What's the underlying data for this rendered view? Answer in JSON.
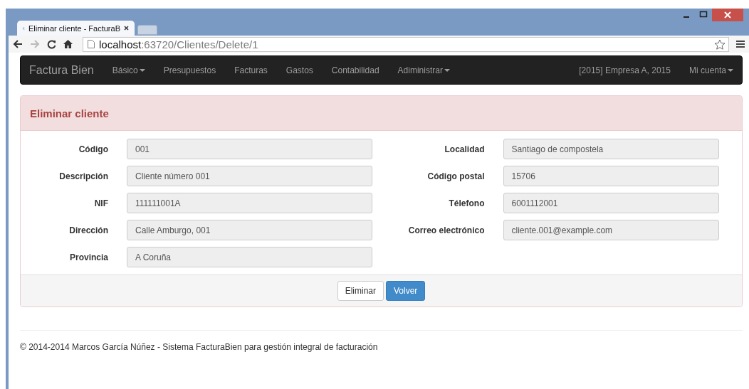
{
  "browser": {
    "tabs": [
      {
        "title": "Eliminar cliente - FacturaB",
        "selected": true
      }
    ],
    "address": {
      "host": "localhost",
      "path": ":63720/Clientes/Delete/1"
    }
  },
  "navbar": {
    "brand": "Factura Bien",
    "items": [
      {
        "label": "Básico",
        "dropdown": true
      },
      {
        "label": "Presupuestos",
        "dropdown": false
      },
      {
        "label": "Facturas",
        "dropdown": false
      },
      {
        "label": "Gastos",
        "dropdown": false
      },
      {
        "label": "Contabilidad",
        "dropdown": false
      },
      {
        "label": "Adiministrar",
        "dropdown": true
      }
    ],
    "right_items": [
      {
        "label": "[2015] Empresa A, 2015",
        "dropdown": false
      },
      {
        "label": "Mi cuenta",
        "dropdown": true
      }
    ]
  },
  "panel": {
    "title": "Eliminar cliente",
    "left_fields": [
      {
        "label": "Código",
        "value": "001"
      },
      {
        "label": "Descripción",
        "value": "Cliente número 001"
      },
      {
        "label": "NIF",
        "value": "111111001A"
      },
      {
        "label": "Dirección",
        "value": "Calle Amburgo, 001"
      },
      {
        "label": "Provincia",
        "value": "A Coruña"
      }
    ],
    "right_fields": [
      {
        "label": "Localidad",
        "value": "Santiago de compostela"
      },
      {
        "label": "Código postal",
        "value": "15706"
      },
      {
        "label": "Télefono",
        "value": "6001112001"
      },
      {
        "label": "Correo electrónico",
        "value": "cliente.001@example.com"
      }
    ],
    "buttons": [
      {
        "label": "Eliminar",
        "kind": "default"
      },
      {
        "label": "Volver",
        "kind": "primary"
      }
    ]
  },
  "footer": {
    "text": "© 2014-2014 Marcos García Núñez - Sistema FacturaBien para gestión integral de facturación"
  }
}
